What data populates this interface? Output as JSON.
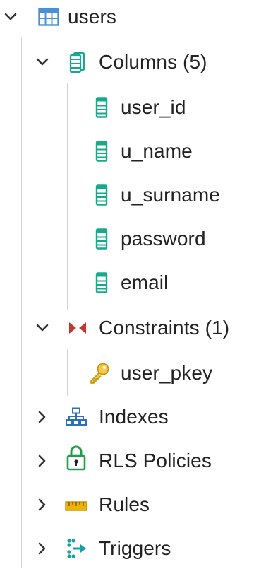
{
  "tree": {
    "table": {
      "label": "users",
      "icon": "table-icon",
      "expanded": true
    },
    "columns_group": {
      "label": "Columns (5)",
      "icon": "columns-icon",
      "expanded": true,
      "items": [
        {
          "label": "user_id",
          "icon": "column-icon"
        },
        {
          "label": "u_name",
          "icon": "column-icon"
        },
        {
          "label": "u_surname",
          "icon": "column-icon"
        },
        {
          "label": "password",
          "icon": "column-icon"
        },
        {
          "label": "email",
          "icon": "column-icon"
        }
      ]
    },
    "constraints_group": {
      "label": "Constraints (1)",
      "icon": "constraints-icon",
      "expanded": true,
      "items": [
        {
          "label": "user_pkey",
          "icon": "primary-key-icon"
        }
      ]
    },
    "indexes": {
      "label": "Indexes",
      "icon": "indexes-icon",
      "expanded": false
    },
    "rls_policies": {
      "label": "RLS Policies",
      "icon": "lock-icon",
      "expanded": false
    },
    "rules": {
      "label": "Rules",
      "icon": "rules-icon",
      "expanded": false
    },
    "triggers": {
      "label": "Triggers",
      "icon": "triggers-icon",
      "expanded": false
    }
  },
  "colors": {
    "table_blue": "#4a90d9",
    "column_teal": "#18a88a",
    "constraint_red": "#c0392b",
    "key_yellow": "#e8b923",
    "rules_yellow": "#f0b400",
    "index_blue": "#2f6fba",
    "lock_green": "#1e9e4a",
    "trigger_teal": "#1aa0a0"
  }
}
